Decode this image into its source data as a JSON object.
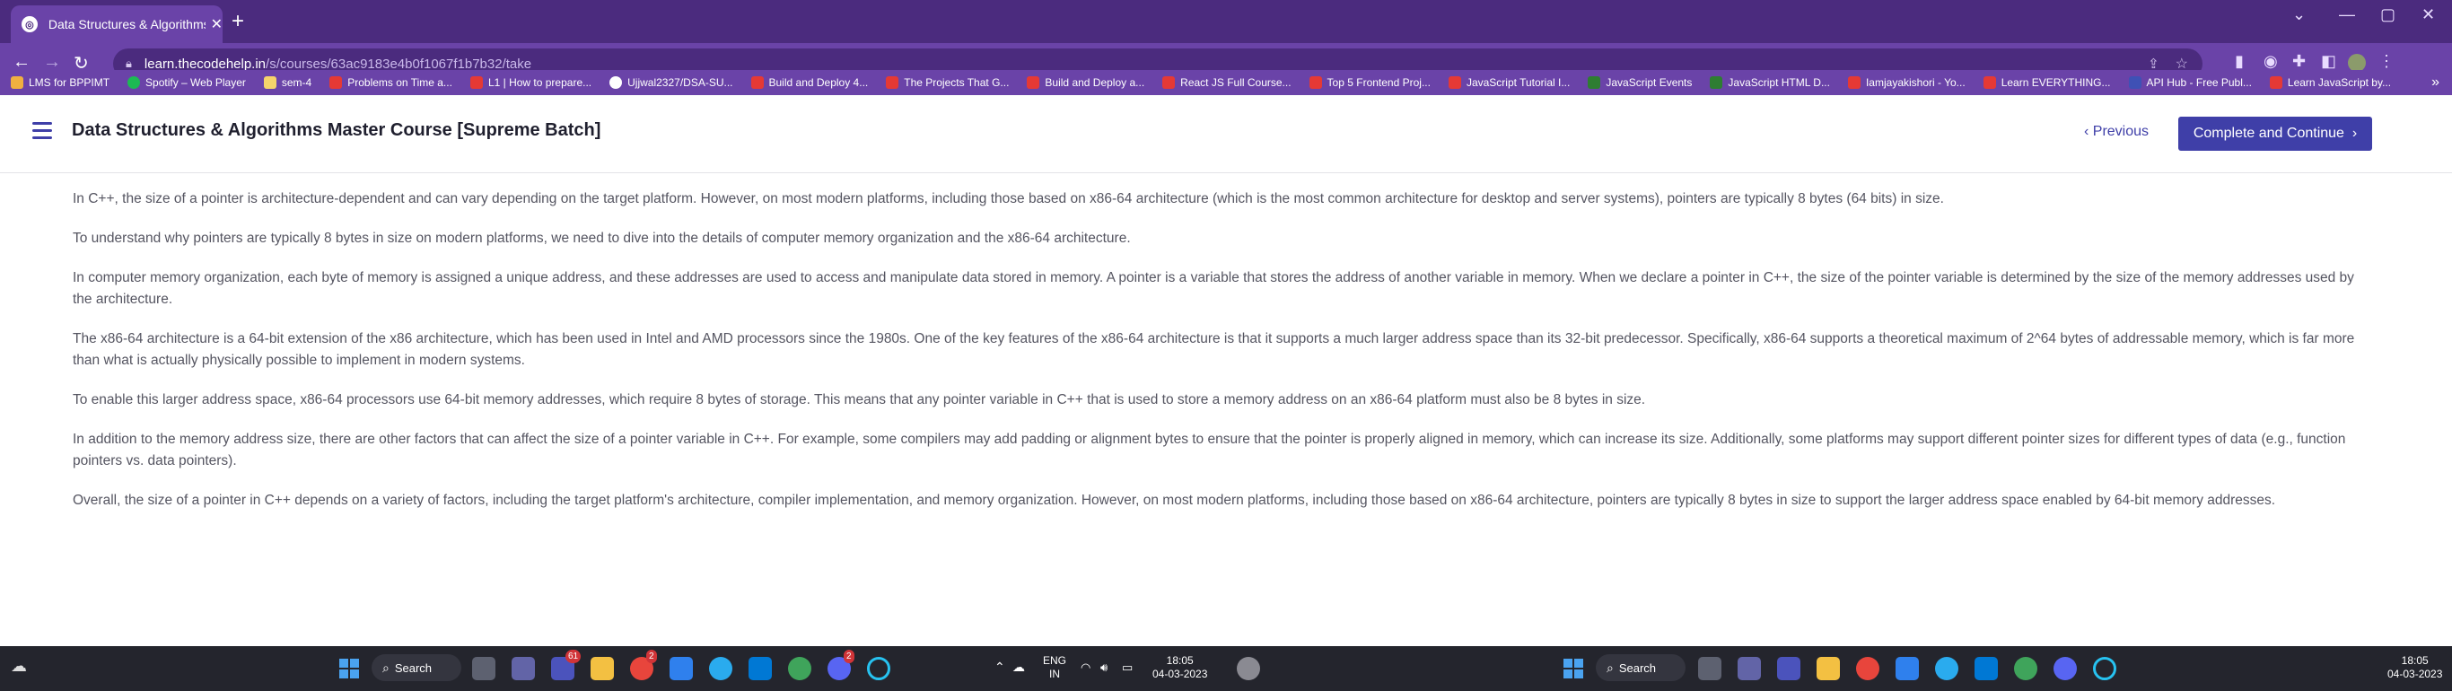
{
  "browser": {
    "tab_title": "Data Structures & Algorithms Ma",
    "url_host": "learn.thecodehelp.in",
    "url_path": "/s/courses/63ac9183e4b0f1067f1b7b32/take"
  },
  "bookmarks": [
    {
      "label": "LMS for BPPIMT",
      "color": "#f0b040"
    },
    {
      "label": "Spotify – Web Player",
      "color": "#1db954"
    },
    {
      "label": "sem-4",
      "color": "#f6d36b"
    },
    {
      "label": "Problems on Time a...",
      "color": "#e53935"
    },
    {
      "label": "L1 | How to prepare...",
      "color": "#e53935"
    },
    {
      "label": "Ujjwal2327/DSA-SU...",
      "color": "#ffffff"
    },
    {
      "label": "Build and Deploy 4...",
      "color": "#e53935"
    },
    {
      "label": "The Projects That G...",
      "color": "#e53935"
    },
    {
      "label": "Build and Deploy a...",
      "color": "#e53935"
    },
    {
      "label": "React JS Full Course...",
      "color": "#e53935"
    },
    {
      "label": "Top 5 Frontend Proj...",
      "color": "#e53935"
    },
    {
      "label": "JavaScript Tutorial I...",
      "color": "#e53935"
    },
    {
      "label": "JavaScript Events",
      "color": "#2e7d32"
    },
    {
      "label": "JavaScript HTML D...",
      "color": "#2e7d32"
    },
    {
      "label": "Iamjayakishori - Yo...",
      "color": "#e53935"
    },
    {
      "label": "Learn EVERYTHING...",
      "color": "#e53935"
    },
    {
      "label": "API Hub - Free Publ...",
      "color": "#3f51b5"
    },
    {
      "label": "Learn JavaScript by...",
      "color": "#e53935"
    }
  ],
  "header": {
    "course_title": "Data Structures & Algorithms Master Course [Supreme Batch]",
    "previous_label": "Previous",
    "continue_label": "Complete and Continue"
  },
  "content": {
    "paragraphs": [
      "In C++, the size of a pointer is architecture-dependent and can vary depending on the target platform. However, on most modern platforms, including those based on x86-64 architecture (which is the most common architecture for desktop and server systems), pointers are typically 8 bytes (64 bits) in size.",
      "To understand why pointers are typically 8 bytes in size on modern platforms, we need to dive into the details of computer memory organization and the x86-64 architecture.",
      "In computer memory organization, each byte of memory is assigned a unique address, and these addresses are used to access and manipulate data stored in memory. A pointer is a variable that stores the address of another variable in memory. When we declare a pointer in C++, the size of the pointer variable is determined by the size of the memory addresses used by the architecture.",
      "The x86-64 architecture is a 64-bit extension of the x86 architecture, which has been used in Intel and AMD processors since the 1980s. One of the key features of the x86-64 architecture is that it supports a much larger address space than its 32-bit predecessor. Specifically, x86-64 supports a theoretical maximum of 2^64 bytes of addressable memory, which is far more than what is actually physically possible to implement in modern systems.",
      "To enable this larger address space, x86-64 processors use 64-bit memory addresses, which require 8 bytes of storage. This means that any pointer variable in C++ that is used to store a memory address on an x86-64 platform must also be 8 bytes in size.",
      "In addition to the memory address size, there are other factors that can affect the size of a pointer variable in C++. For example, some compilers may add padding or alignment bytes to ensure that the pointer is properly aligned in memory, which can increase its size. Additionally, some platforms may support different pointer sizes for different types of data (e.g., function pointers vs. data pointers).",
      "Overall, the size of a pointer in C++ depends on a variety of factors, including the target platform's architecture, compiler implementation, and memory organization. However, on most modern platforms, including those based on x86-64 architecture, pointers are typically 8 bytes in size to support the larger address space enabled by 64-bit memory addresses."
    ]
  },
  "taskbar": {
    "search_label": "Search",
    "search_label_2": "Search",
    "lang_1": "ENG",
    "lang_2": "IN",
    "time": "18:05",
    "date": "04-03-2023",
    "time_2": "18:05",
    "date_2": "04-03-2023",
    "badge_teams": "61",
    "badge_chrome": "2",
    "badge_discord": "2"
  },
  "colors": {
    "brand": "#3f3fa8",
    "chrome_dark": "#4b2b7e",
    "chrome_light": "#6a43a8",
    "taskbar": "#24252d"
  }
}
